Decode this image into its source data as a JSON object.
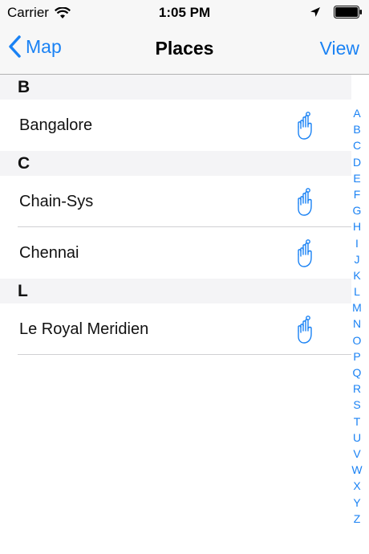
{
  "status_bar": {
    "carrier": "Carrier",
    "time": "1:05 PM"
  },
  "nav": {
    "back_label": "Map",
    "title": "Places",
    "right_label": "View"
  },
  "sections": [
    {
      "letter": "B",
      "rows": [
        "Bangalore"
      ]
    },
    {
      "letter": "C",
      "rows": [
        "Chain-Sys",
        "Chennai"
      ]
    },
    {
      "letter": "L",
      "rows": [
        "Le Royal Meridien"
      ]
    }
  ],
  "index": [
    "A",
    "B",
    "C",
    "D",
    "E",
    "F",
    "G",
    "H",
    "I",
    "J",
    "K",
    "L",
    "M",
    "N",
    "O",
    "P",
    "Q",
    "R",
    "S",
    "T",
    "U",
    "V",
    "W",
    "X",
    "Y",
    "Z"
  ],
  "colors": {
    "accent": "#1a82f4",
    "bar_background": "#f7f7f7",
    "section_background": "#f4f4f6"
  },
  "icons": {
    "row_icon": "hand-ring-finger-icon",
    "back": "chevron-left-icon",
    "wifi": "wifi-icon",
    "location": "location-arrow-icon",
    "battery": "battery-icon"
  }
}
